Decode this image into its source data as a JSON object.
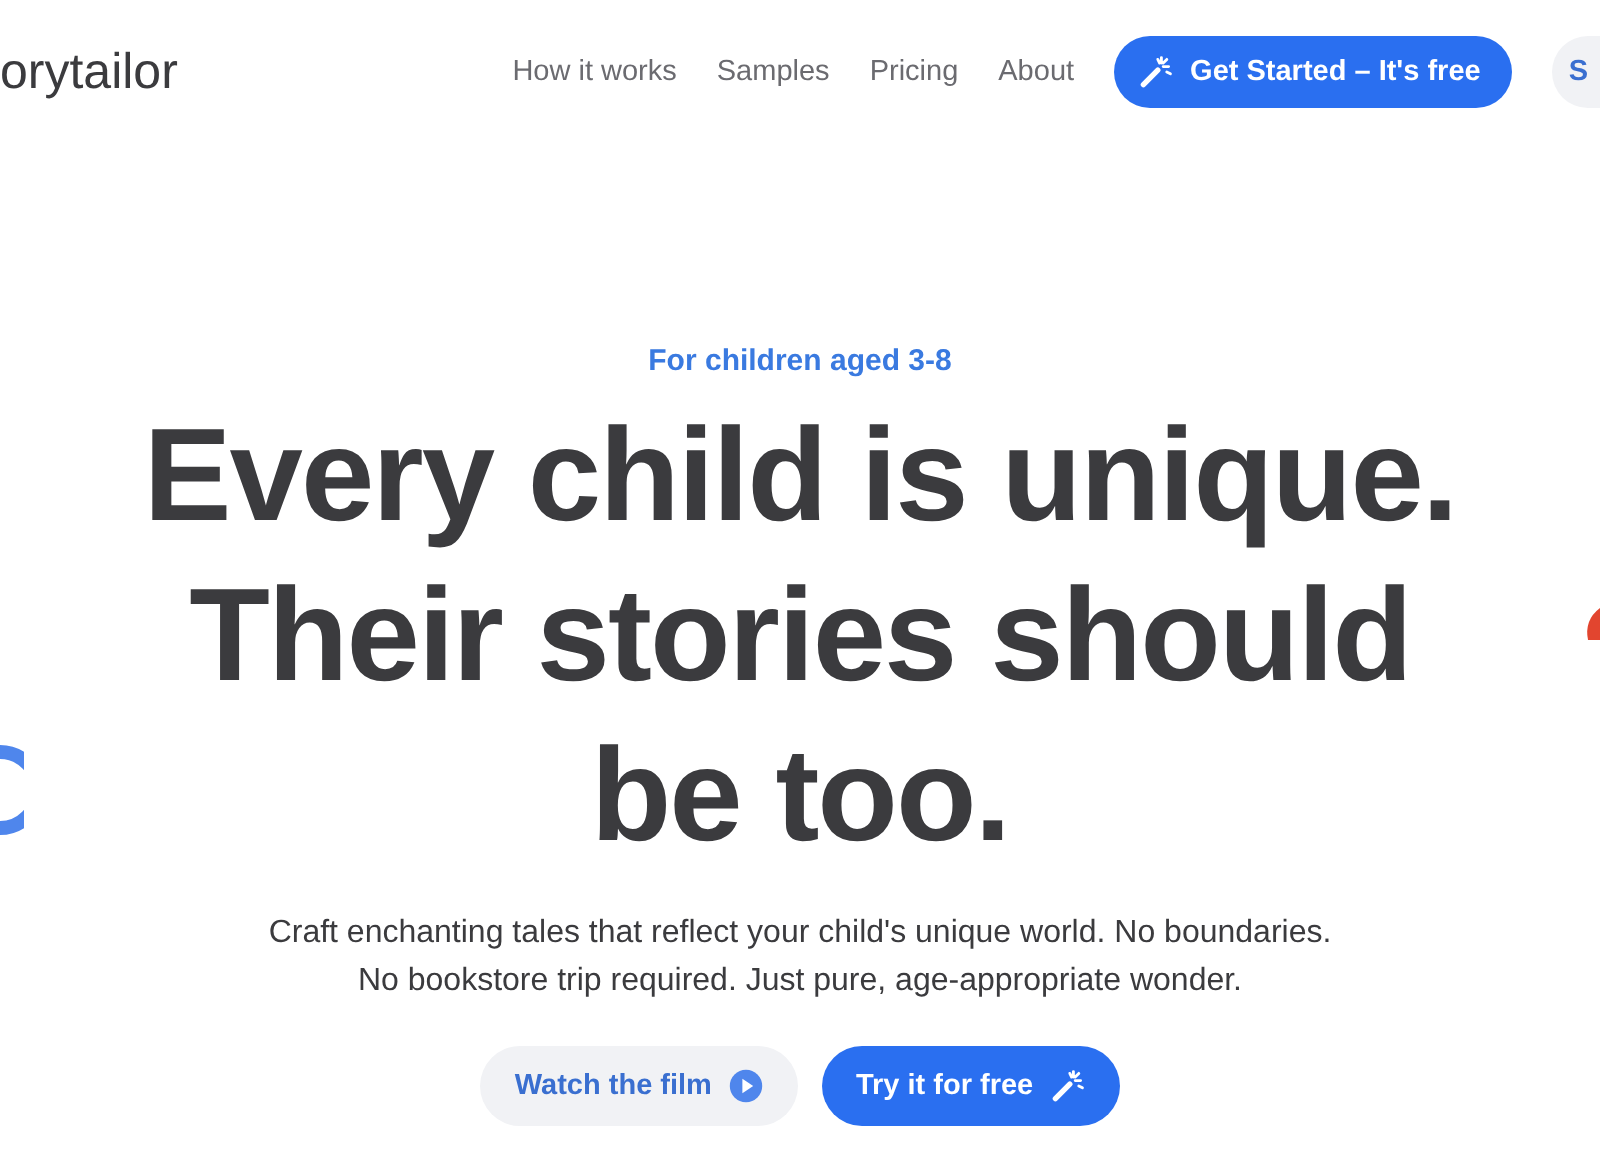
{
  "header": {
    "logo": "orytailor",
    "nav": [
      {
        "label": "How it works"
      },
      {
        "label": "Samples"
      },
      {
        "label": "Pricing"
      },
      {
        "label": "About"
      }
    ],
    "cta": {
      "label": "Get Started – It's free"
    },
    "secondary_button": {
      "label": "S"
    }
  },
  "hero": {
    "eyebrow": "For children aged 3-8",
    "headline": [
      "Every child is unique.",
      "Their stories should",
      "be too."
    ],
    "subtitle": [
      "Craft enchanting tales that reflect your child's unique world. No boundaries.",
      "No bookstore trip required. Just pure, age-appropriate wonder."
    ],
    "buttons": [
      {
        "kind": "secondary",
        "label": "Watch the film"
      },
      {
        "kind": "primary",
        "label": "Try it for free"
      }
    ]
  }
}
